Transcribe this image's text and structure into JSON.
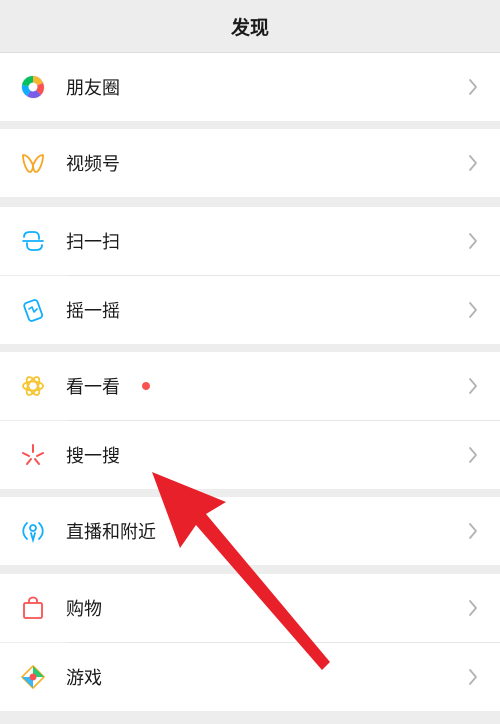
{
  "header": {
    "title": "发现"
  },
  "rows": [
    {
      "label": "朋友圈",
      "icon": "moments-icon"
    },
    {
      "label": "视频号",
      "icon": "channels-icon"
    },
    {
      "label": "扫一扫",
      "icon": "scan-icon"
    },
    {
      "label": "摇一摇",
      "icon": "shake-icon"
    },
    {
      "label": "看一看",
      "icon": "top-stories-icon",
      "badge": "red-dot"
    },
    {
      "label": "搜一搜",
      "icon": "search-icon"
    },
    {
      "label": "直播和附近",
      "icon": "live-nearby-icon"
    },
    {
      "label": "购物",
      "icon": "shopping-icon"
    },
    {
      "label": "游戏",
      "icon": "games-icon"
    }
  ],
  "colors": {
    "background": "#ededed",
    "row": "#ffffff",
    "text": "#1a1a1a",
    "chevron": "#b2b2b2",
    "badge": "#fa5151",
    "annotation_arrow": "#e8202a"
  }
}
